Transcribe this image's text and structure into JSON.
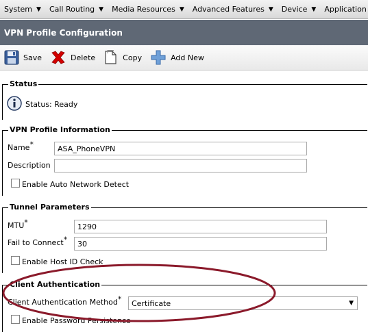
{
  "menu": {
    "items": [
      {
        "label": "System"
      },
      {
        "label": "Call Routing"
      },
      {
        "label": "Media Resources"
      },
      {
        "label": "Advanced Features"
      },
      {
        "label": "Device"
      },
      {
        "label": "Application"
      }
    ]
  },
  "page": {
    "title": "VPN Profile Configuration"
  },
  "toolbar": {
    "save_label": "Save",
    "delete_label": "Delete",
    "copy_label": "Copy",
    "add_new_label": "Add New"
  },
  "status": {
    "section_title": "Status",
    "text": "Status: Ready"
  },
  "vpn_profile": {
    "section_title": "VPN Profile Information",
    "name_label": "Name",
    "name_value": "ASA_PhoneVPN",
    "description_label": "Description",
    "description_value": "",
    "auto_detect_label": "Enable Auto Network Detect",
    "auto_detect_checked": false
  },
  "tunnel": {
    "section_title": "Tunnel Parameters",
    "mtu_label": "MTU",
    "mtu_value": "1290",
    "fail_label": "Fail to Connect",
    "fail_value": "30",
    "host_id_label": "Enable Host ID Check",
    "host_id_checked": false
  },
  "client_auth": {
    "section_title": "Client Authentication",
    "method_label": "Client Authentication Method",
    "method_value": "Certificate",
    "password_persistence_label": "Enable Password Persistence",
    "password_persistence_checked": false
  },
  "required_marker": "*",
  "colors": {
    "title_bar": "#5f6875",
    "highlight_ellipse": "#8b1a2b",
    "delete_icon": "#d40000"
  }
}
